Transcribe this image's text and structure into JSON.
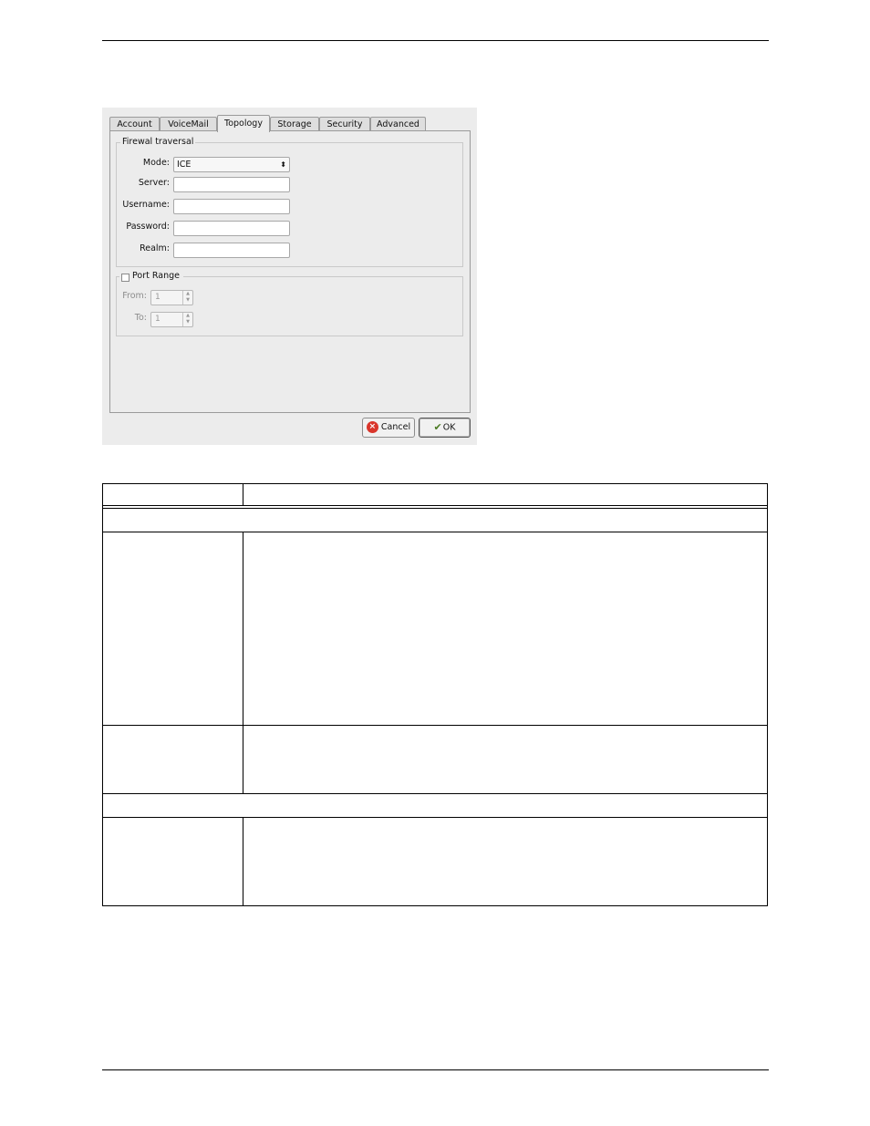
{
  "dialog": {
    "tabs": [
      {
        "label": "Account"
      },
      {
        "label": "VoiceMail"
      },
      {
        "label": "Topology"
      },
      {
        "label": "Storage"
      },
      {
        "label": "Security"
      },
      {
        "label": "Advanced"
      }
    ],
    "active_tab": "Topology",
    "firewall": {
      "title": "Firewal traversal",
      "mode_label": "Mode:",
      "mode_value": "ICE",
      "server_label": "Server:",
      "server_value": "",
      "username_label": "Username:",
      "username_value": "",
      "password_label": "Password:",
      "password_value": "",
      "realm_label": "Realm:",
      "realm_value": ""
    },
    "port_range": {
      "title": "Port Range",
      "checked": false,
      "from_label": "From:",
      "from_value": "1",
      "to_label": "To:",
      "to_value": "1"
    },
    "buttons": {
      "cancel": "Cancel",
      "ok": "OK"
    }
  },
  "icons": {
    "spin_up": "up-arrow-icon",
    "spin_down": "down-arrow-icon",
    "combo": "updown-arrows-icon",
    "cancel": "cancel-icon",
    "ok": "ok-icon"
  }
}
